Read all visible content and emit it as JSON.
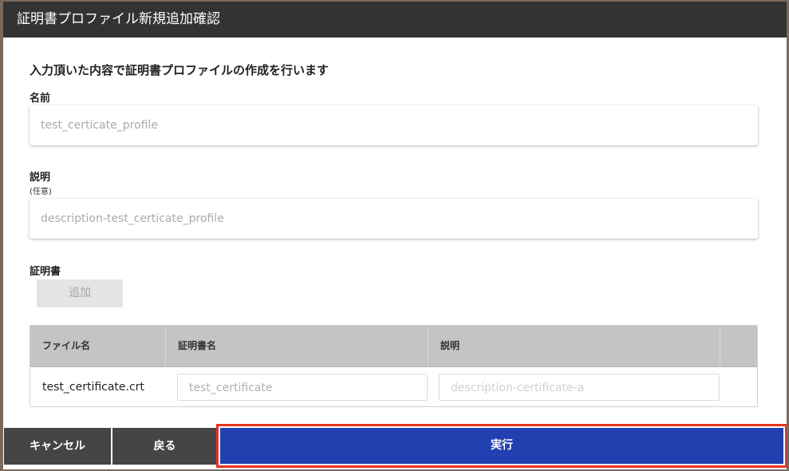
{
  "dialog": {
    "title": "証明書プロファイル新規追加確認",
    "intro": "入力頂いた内容で証明書プロファイルの作成を行います"
  },
  "fields": {
    "name": {
      "label": "名前",
      "value": "test_certicate_profile"
    },
    "description": {
      "label": "説明",
      "note": "(任意)",
      "value": "description-test_certicate_profile"
    },
    "certificate": {
      "label": "証明書",
      "add_label": "追加"
    }
  },
  "table": {
    "headers": [
      "ファイル名",
      "証明書名",
      "説明",
      ""
    ],
    "rows": [
      {
        "file_name": "test_certificate.crt",
        "cert_name": "test_certificate",
        "description": "description-certificate-a"
      }
    ]
  },
  "footer": {
    "cancel_label": "キャンセル",
    "back_label": "戻る",
    "execute_label": "実行"
  },
  "colors": {
    "titlebar": "#333333",
    "execute": "#2340b1",
    "highlight": "#e8321f",
    "footer_button": "#454545"
  }
}
